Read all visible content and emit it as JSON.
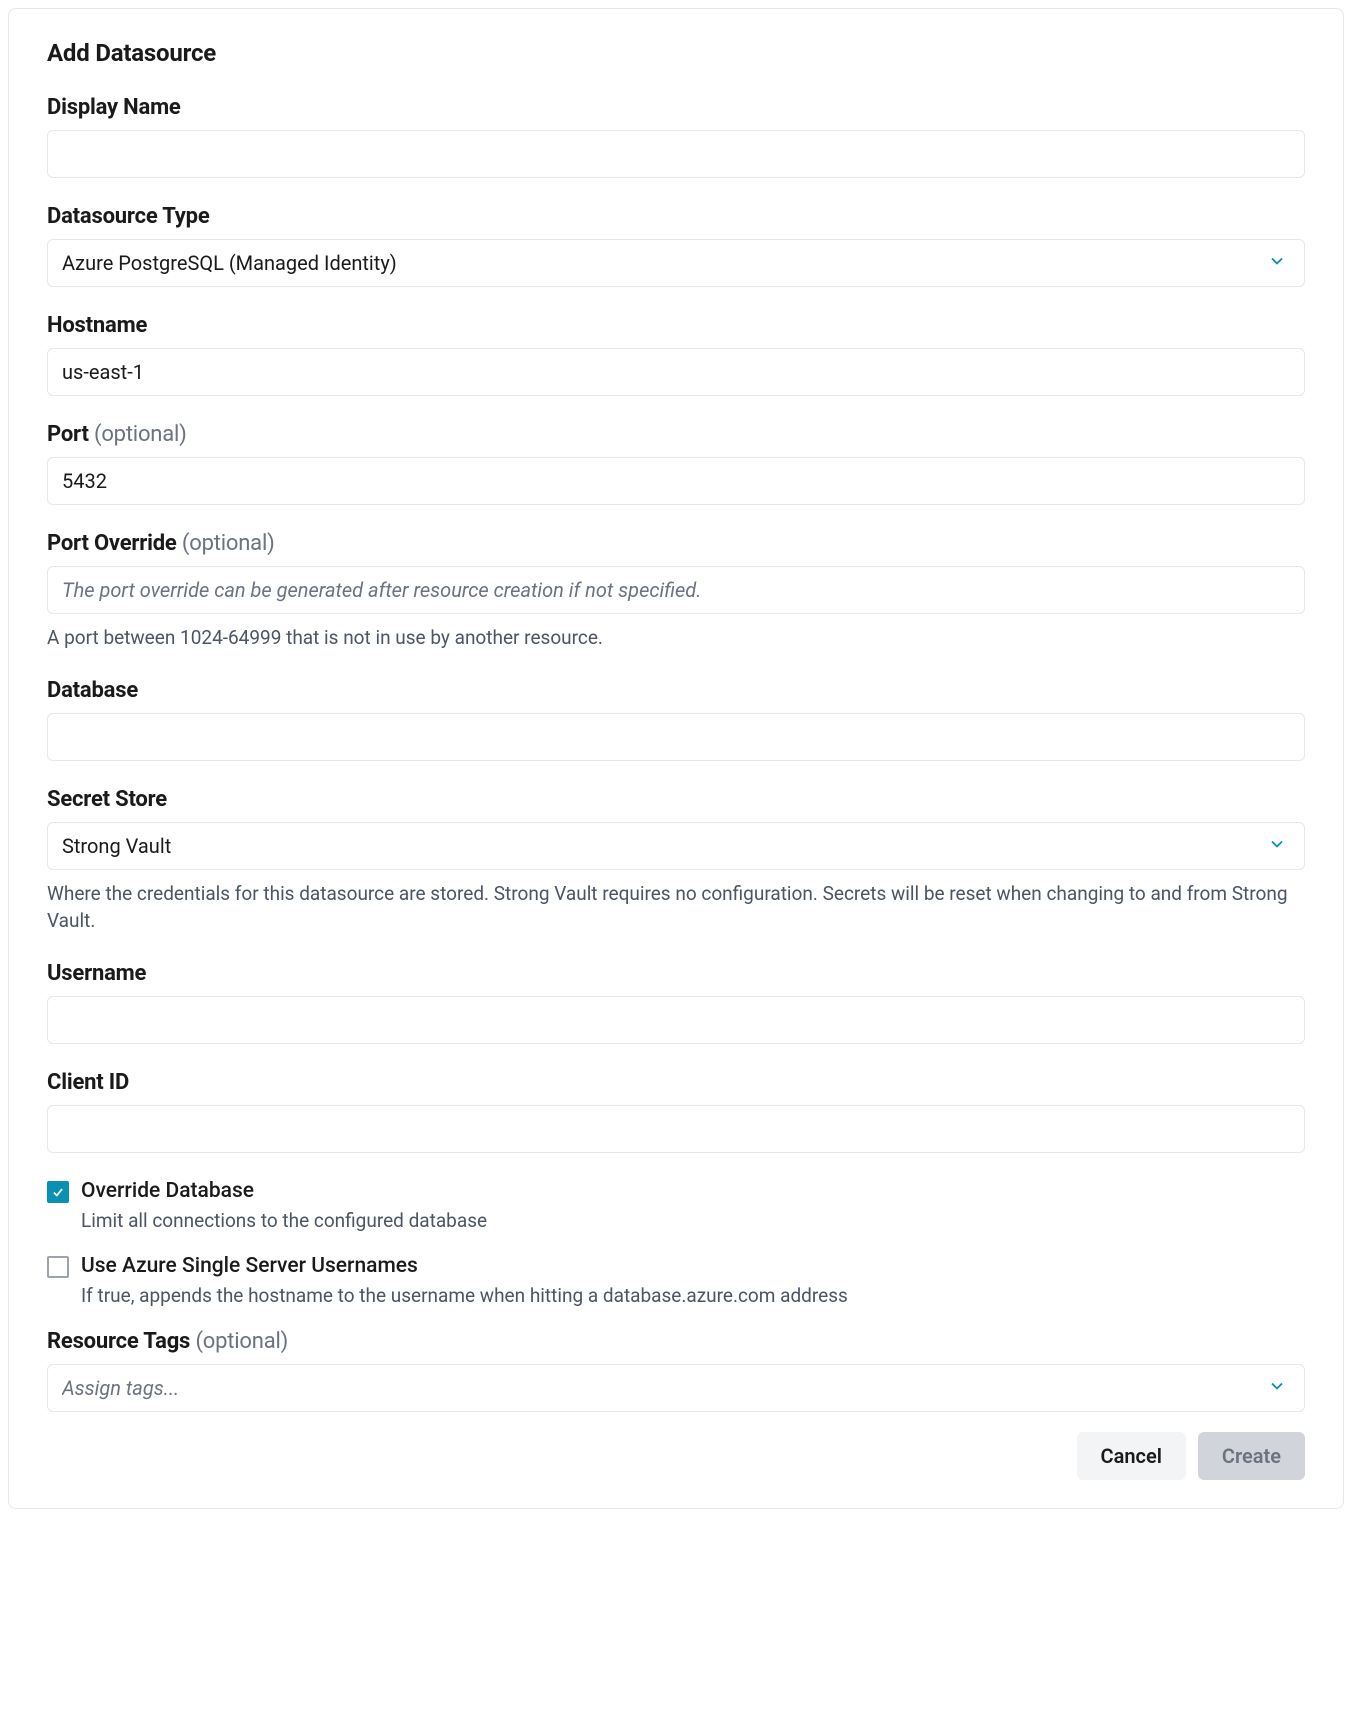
{
  "title": "Add Datasource",
  "fields": {
    "display_name": {
      "label": "Display Name",
      "value": ""
    },
    "datasource_type": {
      "label": "Datasource Type",
      "value": "Azure PostgreSQL (Managed Identity)"
    },
    "hostname": {
      "label": "Hostname",
      "value": "us-east-1"
    },
    "port": {
      "label": "Port",
      "optional": "(optional)",
      "value": "5432"
    },
    "port_override": {
      "label": "Port Override",
      "optional": "(optional)",
      "placeholder": "The port override can be generated after resource creation if not specified.",
      "help": "A port between 1024-64999 that is not in use by another resource."
    },
    "database": {
      "label": "Database",
      "value": ""
    },
    "secret_store": {
      "label": "Secret Store",
      "value": "Strong Vault",
      "help": "Where the credentials for this datasource are stored. Strong Vault requires no configuration. Secrets will be reset when changing to and from Strong Vault."
    },
    "username": {
      "label": "Username",
      "value": ""
    },
    "client_id": {
      "label": "Client ID",
      "value": ""
    },
    "override_database": {
      "label": "Override Database",
      "help": "Limit all connections to the configured database",
      "checked": true
    },
    "use_azure_single": {
      "label": "Use Azure Single Server Usernames",
      "help": "If true, appends the hostname to the username when hitting a database.azure.com address",
      "checked": false
    },
    "resource_tags": {
      "label": "Resource Tags",
      "optional": "(optional)",
      "placeholder": "Assign tags..."
    }
  },
  "buttons": {
    "cancel": "Cancel",
    "create": "Create"
  }
}
